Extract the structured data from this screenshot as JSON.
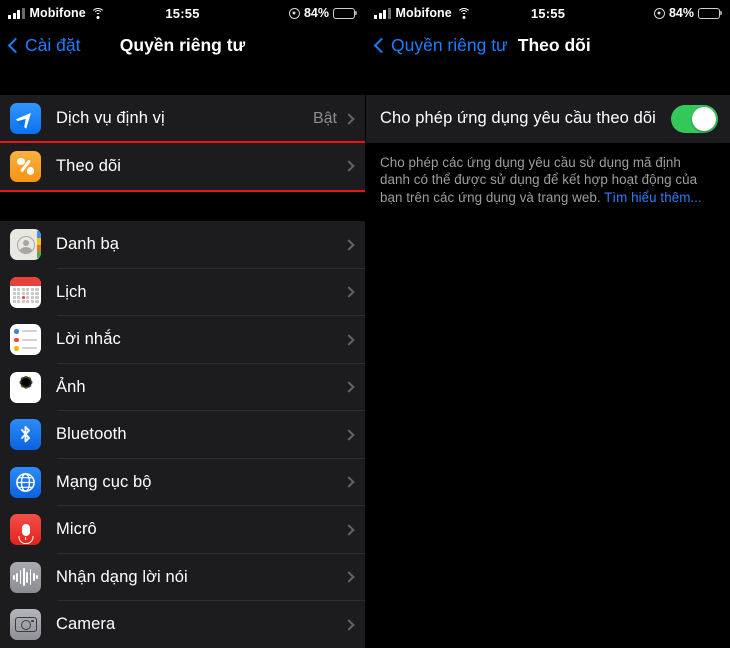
{
  "left": {
    "status": {
      "carrier": "Mobifone",
      "time": "15:55",
      "battery_pct": "84%"
    },
    "nav": {
      "back_label": "Cài đặt",
      "title": "Quyền riêng tư"
    },
    "sections": [
      {
        "rows": [
          {
            "icon": "location-services-icon",
            "label": "Dịch vụ định vị",
            "value": "Bật"
          },
          {
            "icon": "tracking-icon",
            "label": "Theo dõi",
            "value": "",
            "highlighted": true
          }
        ]
      },
      {
        "rows": [
          {
            "icon": "contacts-icon",
            "label": "Danh bạ",
            "value": ""
          },
          {
            "icon": "calendar-icon",
            "label": "Lịch",
            "value": ""
          },
          {
            "icon": "reminders-icon",
            "label": "Lời nhắc",
            "value": ""
          },
          {
            "icon": "photos-icon",
            "label": "Ảnh",
            "value": ""
          },
          {
            "icon": "bluetooth-icon",
            "label": "Bluetooth",
            "value": ""
          },
          {
            "icon": "local-network-icon",
            "label": "Mạng cục bộ",
            "value": ""
          },
          {
            "icon": "microphone-icon",
            "label": "Micrô",
            "value": ""
          },
          {
            "icon": "speech-recognition-icon",
            "label": "Nhận dạng lời nói",
            "value": ""
          },
          {
            "icon": "camera-icon",
            "label": "Camera",
            "value": ""
          }
        ]
      }
    ]
  },
  "right": {
    "status": {
      "carrier": "Mobifone",
      "time": "15:55",
      "battery_pct": "84%"
    },
    "nav": {
      "back_label": "Quyền riêng tư",
      "title": "Theo dõi"
    },
    "toggle": {
      "label": "Cho phép ứng dụng yêu cầu theo dõi",
      "state": "on"
    },
    "footnote": {
      "text": "Cho phép các ứng dụng yêu cầu sử dụng mã định danh có thể được sử dụng để kết hợp hoạt động của bạn trên các ứng dụng và trang web. ",
      "link": "Tìm hiểu thêm..."
    }
  },
  "colors": {
    "accent_blue": "#1d7efd",
    "toggle_green": "#34c759",
    "highlight_red": "#e81616",
    "row_bg": "#1c1c1e",
    "page_bg": "#000000"
  }
}
